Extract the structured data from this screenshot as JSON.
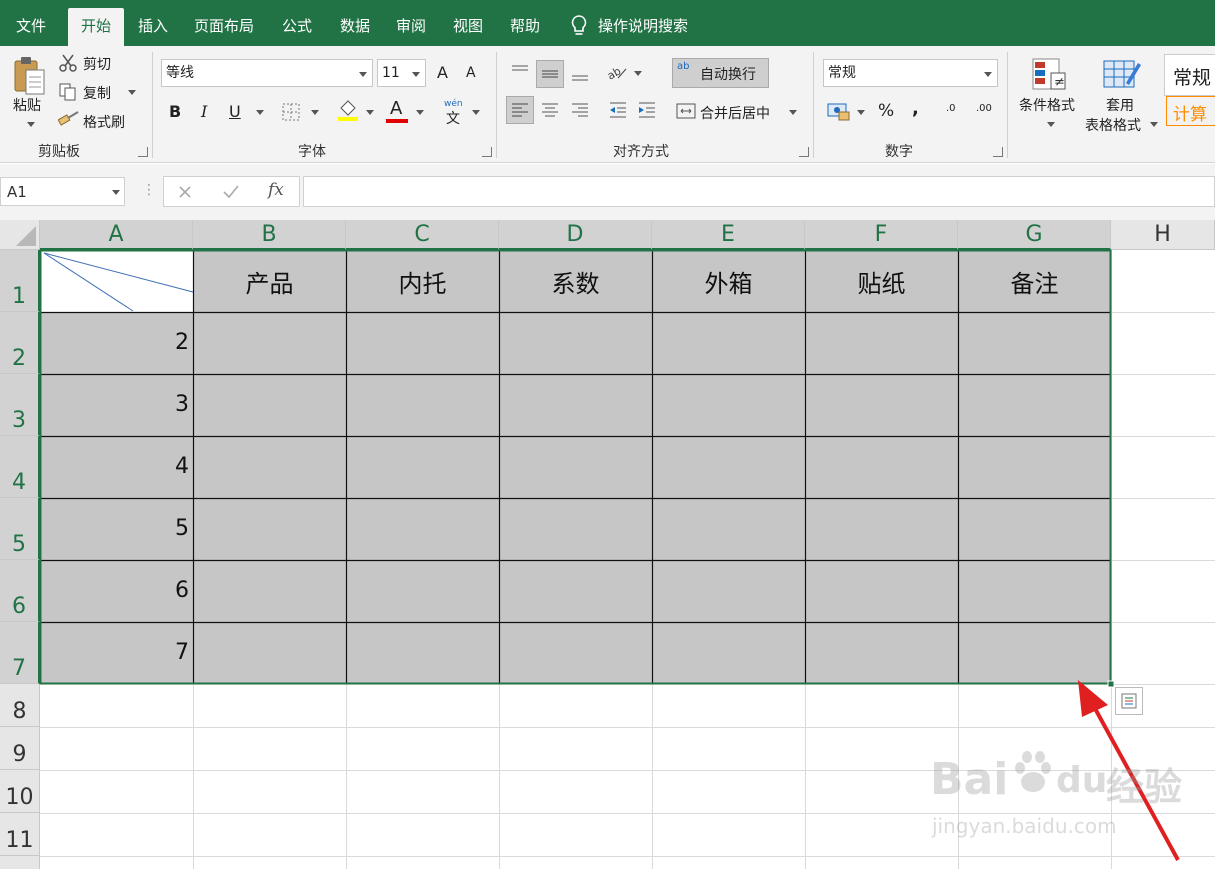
{
  "tabs": [
    "文件",
    "开始",
    "插入",
    "页面布局",
    "公式",
    "数据",
    "审阅",
    "视图",
    "帮助"
  ],
  "tell_me": "操作说明搜索",
  "clipboard": {
    "paste": "粘贴",
    "cut": "剪切",
    "copy": "复制",
    "format_painter": "格式刷",
    "group": "剪贴板"
  },
  "font": {
    "name": "等线",
    "size": "11",
    "group": "字体",
    "grow": "A",
    "shrink": "A",
    "bold": "B",
    "italic": "I",
    "underline": "U",
    "color": "A",
    "phonetic_top": "wén",
    "phonetic_char": "文"
  },
  "alignment": {
    "wrap": "自动换行",
    "merge": "合并后居中",
    "group": "对齐方式",
    "wrap_icon": "ab"
  },
  "number": {
    "format": "常规",
    "percent": "%",
    "comma": ",",
    "group": "数字",
    "inc_dec": ".0",
    "dec_dec": ".00"
  },
  "styles": {
    "conditional": "条件格式",
    "table_format_1": "套用",
    "table_format_2": "表格格式",
    "normal": "常规",
    "calc": "计算"
  },
  "namebox": "A1",
  "fx": "fx",
  "columns": [
    "A",
    "B",
    "C",
    "D",
    "E",
    "F",
    "G",
    "H"
  ],
  "rows": [
    "1",
    "2",
    "3",
    "4",
    "5",
    "6",
    "7",
    "8",
    "9",
    "10",
    "11"
  ],
  "headers": [
    "产品",
    "内托",
    "系数",
    "外箱",
    "贴纸",
    "备注"
  ],
  "col_a_values": [
    "2",
    "3",
    "4",
    "5",
    "6",
    "7"
  ],
  "watermark": {
    "brand": "Bai",
    "suffix": "du",
    "cn": "经验",
    "url": "jingyan.baidu.com"
  },
  "colors": {
    "excel_green": "#217346",
    "selection_fill": "#c6c6c6",
    "arrow_red": "#e02020"
  }
}
